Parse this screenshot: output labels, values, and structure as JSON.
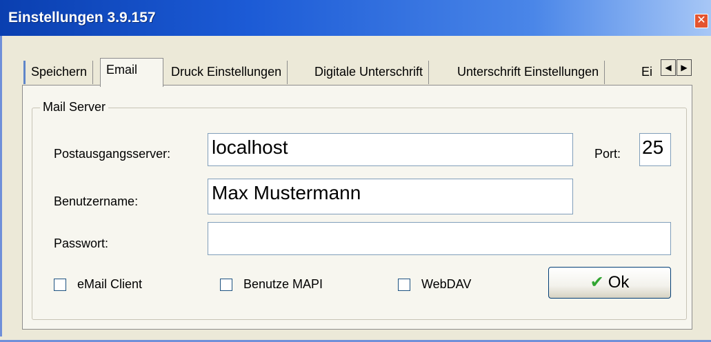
{
  "window": {
    "title": "Einstellungen 3.9.157"
  },
  "tabs": [
    {
      "label": "Speichern",
      "active": false
    },
    {
      "label": "Email",
      "active": true
    },
    {
      "label": "Druck Einstellungen",
      "active": false
    },
    {
      "label": "Digitale Unterschrift",
      "active": false
    },
    {
      "label": "Unterschrift Einstellungen",
      "active": false
    },
    {
      "label": "Ei",
      "active": false
    }
  ],
  "mail_server": {
    "group_label": "Mail Server",
    "outgoing_server_label": "Postausgangsserver:",
    "outgoing_server_value": "localhost",
    "port_label": "Port:",
    "port_value": "25",
    "username_label": "Benutzername:",
    "username_value": "Max Mustermann",
    "password_label": "Passwort:",
    "password_value": ""
  },
  "options": {
    "email_client_label": "eMail Client",
    "email_client_checked": false,
    "mapi_label": "Benutze MAPI",
    "mapi_checked": false,
    "webdav_label": "WebDAV",
    "webdav_checked": false
  },
  "ok_button": {
    "label": "Ok"
  },
  "icons": {
    "close": "close-icon",
    "ok": "checkmark-icon",
    "tab_left": "arrow-left-icon",
    "tab_right": "arrow-right-icon"
  }
}
